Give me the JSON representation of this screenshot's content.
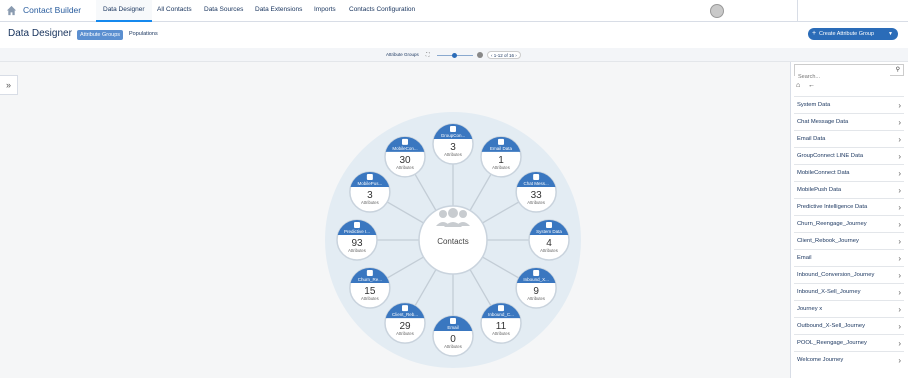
{
  "topnav": {
    "app_title": "Contact Builder",
    "tabs": [
      "Data Designer",
      "All Contacts",
      "Data Sources",
      "Data Extensions",
      "Imports",
      "Contacts Configuration"
    ]
  },
  "header": {
    "title": "Data Designer",
    "view_toggle_selected": "Attribute Groups",
    "view_toggle_other": "Populations",
    "create_button": "Create Attribute Group"
  },
  "toolbar": {
    "label": "Attribute Groups",
    "pager": "1-12 of 16"
  },
  "graph": {
    "center_label": "Contacts",
    "attributes_label": "Attributes",
    "nodes": [
      {
        "name": "GroupCon...",
        "count": "3",
        "icon": "phone-icon"
      },
      {
        "name": "Email Data",
        "count": "1",
        "icon": "envelope-icon"
      },
      {
        "name": "Chat Mess...",
        "count": "33",
        "icon": "chat-icon"
      },
      {
        "name": "System Data",
        "count": "4",
        "icon": "people-icon"
      },
      {
        "name": "Inbound_X...",
        "count": "9",
        "icon": "people-icon"
      },
      {
        "name": "Inbound_C...",
        "count": "11",
        "icon": "people-icon"
      },
      {
        "name": "Email",
        "count": "0",
        "icon": "chat-icon"
      },
      {
        "name": "Client_Reb...",
        "count": "29",
        "icon": "people-icon"
      },
      {
        "name": "Churn_Re...",
        "count": "15",
        "icon": "people-icon"
      },
      {
        "name": "Predictive I...",
        "count": "93",
        "icon": "cart-icon"
      },
      {
        "name": "MobilePus...",
        "count": "3",
        "icon": "phone-icon"
      },
      {
        "name": "MobileCon...",
        "count": "30",
        "icon": "phone-icon"
      }
    ]
  },
  "panel": {
    "search_placeholder": "Search...",
    "items": [
      "System Data",
      "Chat Message Data",
      "Email Data",
      "GroupConnect LINE Data",
      "MobileConnect Data",
      "MobilePush Data",
      "Predictive Intelligence Data",
      "Churn_Reengage_Journey",
      "Client_Rebook_Journey",
      "Email",
      "Inbound_Conversion_Journey",
      "Inbound_X-Sell_Journey",
      "Journey x",
      "Outbound_X-Sell_Journey",
      "POOL_Reengage_Journey",
      "Welcome Journey"
    ]
  }
}
